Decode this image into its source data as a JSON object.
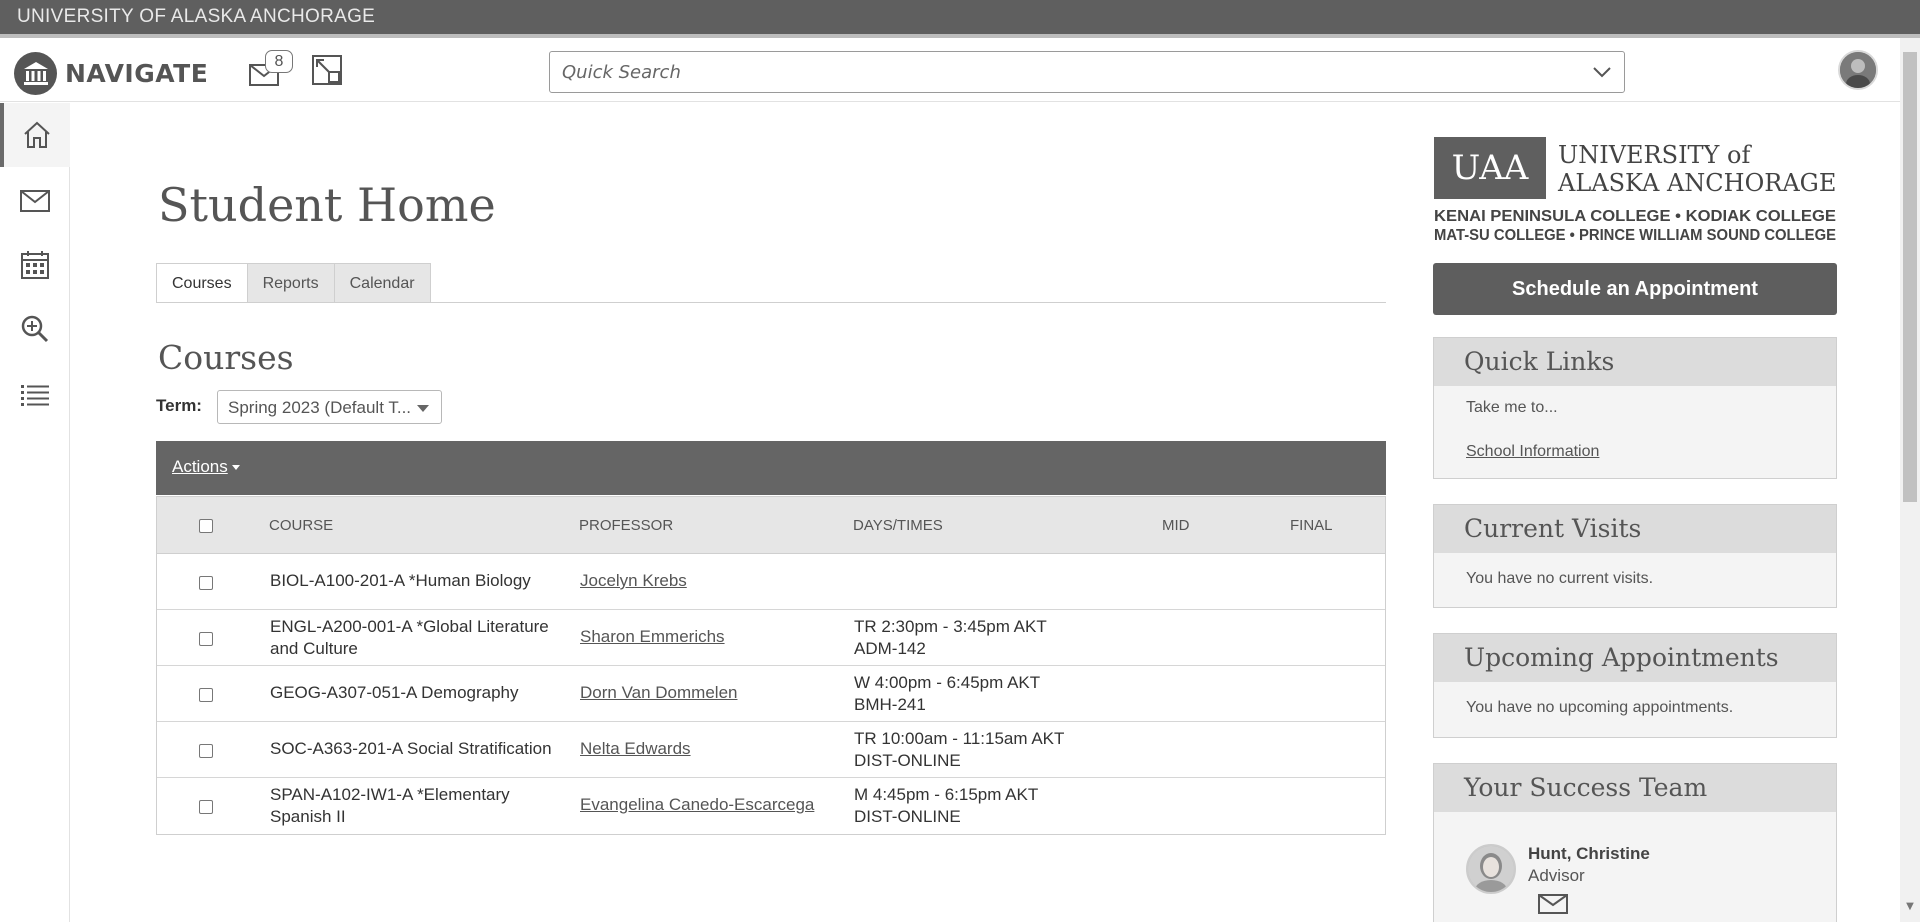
{
  "topbar": {
    "institution": "UNIVERSITY OF ALASKA ANCHORAGE"
  },
  "navbar": {
    "brand": "NAVIGATE",
    "message_count": "8",
    "search_placeholder": "Quick Search"
  },
  "sidebar": {
    "items": [
      {
        "icon": "home-icon"
      },
      {
        "icon": "mail-icon"
      },
      {
        "icon": "calendar-icon"
      },
      {
        "icon": "search-icon"
      },
      {
        "icon": "list-icon"
      }
    ]
  },
  "page": {
    "title": "Student Home",
    "tabs": [
      {
        "label": "Courses"
      },
      {
        "label": "Reports"
      },
      {
        "label": "Calendar"
      }
    ],
    "section_title": "Courses",
    "term_label": "Term:",
    "term_value": "Spring 2023 (Default T...",
    "actions_label": "Actions"
  },
  "table": {
    "headers": {
      "course": "COURSE",
      "professor": "PROFESSOR",
      "days_times": "DAYS/TIMES",
      "mid": "MID",
      "final": "FINAL"
    },
    "rows": [
      {
        "course": "BIOL-A100-201-A *Human Biology",
        "professor": "Jocelyn Krebs",
        "days": "",
        "room": ""
      },
      {
        "course": "ENGL-A200-001-A *Global Literature and Culture",
        "professor": "Sharon Emmerichs",
        "days": "TR 2:30pm - 3:45pm AKT",
        "room": "ADM-142"
      },
      {
        "course": "GEOG-A307-051-A Demography",
        "professor": "Dorn Van Dommelen",
        "days": "W 4:00pm - 6:45pm AKT",
        "room": "BMH-241"
      },
      {
        "course": "SOC-A363-201-A Social Stratification",
        "professor": "Nelta Edwards",
        "days": "TR 10:00am - 11:15am AKT",
        "room": "DIST-ONLINE"
      },
      {
        "course": "SPAN-A102-IW1-A *Elementary Spanish II",
        "professor": "Evangelina Canedo-Escarcega",
        "days": "M 4:45pm - 6:15pm AKT",
        "room": "DIST-ONLINE"
      }
    ]
  },
  "right": {
    "logo": {
      "uaa": "UAA",
      "line1": "UNIVERSITY of",
      "line2": "ALASKA ANCHORAGE.",
      "colleges1": "KENAI PENINSULA COLLEGE  •  KODIAK COLLEGE",
      "colleges2": "MAT-SU COLLEGE  •  PRINCE WILLIAM SOUND COLLEGE"
    },
    "schedule_button": "Schedule an Appointment",
    "quick_links": {
      "title": "Quick Links",
      "intro": "Take me to...",
      "link": "School Information"
    },
    "current_visits": {
      "title": "Current Visits",
      "text": "You have no current visits."
    },
    "upcoming": {
      "title": "Upcoming Appointments",
      "text": "You have no upcoming appointments."
    },
    "team": {
      "title": "Your Success Team",
      "member_name": "Hunt, Christine",
      "member_role": "Advisor"
    }
  },
  "colors": {
    "topbar": "#5f5f5f",
    "actions_bar": "#656565",
    "button": "#5e5e5e",
    "panel_header": "#dcdcdc"
  }
}
